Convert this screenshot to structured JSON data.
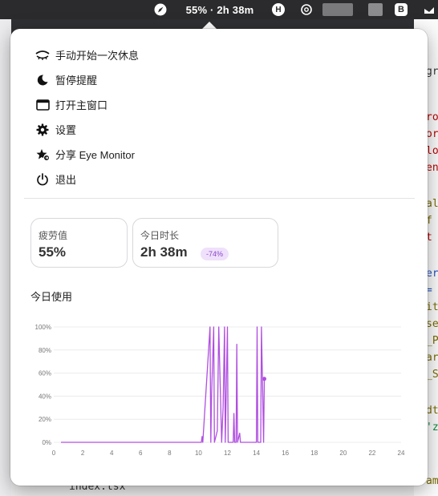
{
  "menubar": {
    "status_text": "55% · 2h 38m",
    "icons": [
      "eye-monitor-icon",
      "h-app-icon",
      "chatgpt-icon",
      "b-app-icon",
      "cloud-icon"
    ]
  },
  "background": {
    "code_fragments": [
      "gr",
      "ro",
      "or",
      "lo",
      "en",
      "al",
      " f",
      "t",
      "er",
      "=",
      "it",
      "se",
      "_P",
      "ar",
      "_S",
      "dt",
      "'z",
      "am"
    ],
    "file_name": "index.tsx"
  },
  "menu": {
    "items": [
      {
        "label": "手动开始一次休息",
        "icon": "closed-eye-icon"
      },
      {
        "label": "暂停提醒",
        "icon": "moon-icon"
      },
      {
        "label": "打开主窗口",
        "icon": "window-icon"
      },
      {
        "label": "设置",
        "icon": "gear-icon"
      },
      {
        "label": "分享 Eye Monitor",
        "icon": "star-share-icon"
      },
      {
        "label": "退出",
        "icon": "power-icon"
      }
    ]
  },
  "stats": {
    "fatigue": {
      "label": "疲劳值",
      "value": "55%"
    },
    "today_duration": {
      "label": "今日时长",
      "value": "2h 38m",
      "change": "-74%"
    }
  },
  "usage": {
    "title": "今日使用"
  },
  "colors": {
    "accent": "#b04fe0",
    "badge_bg": "#efe0fb",
    "badge_text": "#8b47c9"
  },
  "chart_data": {
    "type": "line",
    "title": "",
    "xlabel": "",
    "ylabel": "",
    "xlim": [
      0,
      24
    ],
    "ylim": [
      0,
      100
    ],
    "x_ticks": [
      "0",
      "2",
      "4",
      "6",
      "8",
      "10",
      "12",
      "14",
      "16",
      "18",
      "20",
      "22",
      "24"
    ],
    "y_ticks": [
      "0%",
      "20%",
      "40%",
      "60%",
      "80%",
      "100%"
    ],
    "grid": true,
    "series": [
      {
        "x": [
          0.5,
          10.2,
          10.25,
          10.3,
          10.8,
          10.85,
          10.9,
          11.05,
          11.1,
          11.3,
          11.4,
          11.6,
          11.7,
          11.8,
          11.85,
          12.0,
          12.05,
          12.1,
          12.4,
          12.45,
          12.5,
          12.6,
          12.65,
          12.7,
          12.85,
          12.9,
          13.0,
          14.0,
          14.05,
          14.1,
          14.3,
          14.35,
          14.5,
          14.55
        ],
        "y": [
          0,
          0,
          5,
          0,
          100,
          0,
          40,
          100,
          0,
          10,
          100,
          0,
          30,
          100,
          0,
          100,
          0,
          0,
          0,
          25,
          0,
          0,
          85,
          0,
          8,
          0,
          0,
          0,
          100,
          0,
          0,
          100,
          0,
          55
        ]
      }
    ]
  }
}
